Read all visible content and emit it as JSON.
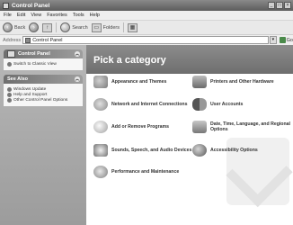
{
  "window": {
    "title": "Control Panel"
  },
  "menubar": {
    "items": [
      "File",
      "Edit",
      "View",
      "Favorites",
      "Tools",
      "Help"
    ]
  },
  "toolbar": {
    "back": "Back",
    "search": "Search",
    "folders": "Folders"
  },
  "address": {
    "label": "Address",
    "value": "Control Panel",
    "go": "Go"
  },
  "sidebar": {
    "control_panel_title": "Control Panel",
    "switch_view": "Switch to Classic View",
    "see_also_title": "See Also",
    "see_also_items": [
      "Windows Update",
      "Help and Support",
      "Other Control Panel Options"
    ]
  },
  "main": {
    "heading": "Pick a category",
    "categories": [
      {
        "label": "Appearance and Themes",
        "icon": "appearance-themes-icon"
      },
      {
        "label": "Printers and Other Hardware",
        "icon": "printers-hardware-icon"
      },
      {
        "label": "Network and Internet Connections",
        "icon": "network-internet-icon"
      },
      {
        "label": "User Accounts",
        "icon": "user-accounts-icon"
      },
      {
        "label": "Add or Remove Programs",
        "icon": "add-remove-programs-icon"
      },
      {
        "label": "Date, Time, Language, and Regional Options",
        "icon": "date-time-regional-icon"
      },
      {
        "label": "Sounds, Speech, and Audio Devices",
        "icon": "sounds-audio-icon"
      },
      {
        "label": "Accessibility Options",
        "icon": "accessibility-icon"
      },
      {
        "label": "Performance and Maintenance",
        "icon": "performance-maintenance-icon"
      }
    ]
  }
}
